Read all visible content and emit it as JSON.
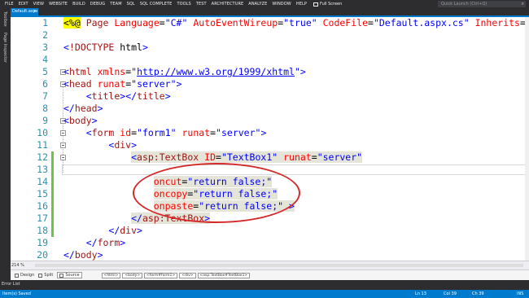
{
  "menubar": {
    "items": [
      "FILE",
      "EDIT",
      "VIEW",
      "WEBSITE",
      "BUILD",
      "DEBUG",
      "TEAM",
      "SQL",
      "SQL COMPLETE",
      "TOOLS",
      "TEST",
      "ARCHITECTURE",
      "ANALYZE",
      "WINDOW",
      "HELP"
    ],
    "fullscreen": "Full Screen",
    "quicklaunch_placeholder": "Quick Launch (Ctrl+Q)"
  },
  "tab": {
    "label": "Default.aspx",
    "close": "×"
  },
  "sidebar": {
    "labels": [
      "Toolbox",
      "Page Inspector"
    ]
  },
  "editor": {
    "lines": [
      {
        "n": "1",
        "text": "<%@ Page Language=\"C#\" AutoEventWireup=\"true\" CodeFile=\"Default.aspx.cs\" Inherits=\"_Def"
      },
      {
        "n": "2",
        "text": ""
      },
      {
        "n": "3",
        "text": "<!DOCTYPE html>"
      },
      {
        "n": "4",
        "text": ""
      },
      {
        "n": "5",
        "text": "<html xmlns=\"http://www.w3.org/1999/xhtml\">"
      },
      {
        "n": "6",
        "text": "<head runat=\"server\">"
      },
      {
        "n": "7",
        "text": "    <title></title>"
      },
      {
        "n": "8",
        "text": "</head>"
      },
      {
        "n": "9",
        "text": "<body>"
      },
      {
        "n": "10",
        "text": "    <form id=\"form1\" runat=\"server\">"
      },
      {
        "n": "11",
        "text": "        <div>"
      },
      {
        "n": "12",
        "text": "            <asp:TextBox ID=\"TextBox1\" runat=\"server\""
      },
      {
        "n": "13",
        "text": ""
      },
      {
        "n": "14",
        "text": "                oncut=\"return false;\""
      },
      {
        "n": "15",
        "text": "                oncopy=\"return false;\""
      },
      {
        "n": "16",
        "text": "                onpaste=\"return false;\" >"
      },
      {
        "n": "17",
        "text": "            </asp:TextBox>"
      },
      {
        "n": "18",
        "text": "        </div>"
      },
      {
        "n": "19",
        "text": "    </form>"
      },
      {
        "n": "20",
        "text": "</body>"
      },
      {
        "n": "21",
        "text": "</html>"
      }
    ]
  },
  "statusrow1": {
    "zoom": "214 %"
  },
  "viewbar": {
    "design": "Design",
    "split": "Split",
    "source": "Source",
    "breadcrumbs": [
      "<html>",
      "<body>",
      "<form#form1>",
      "<div>",
      "<asp:TextBox#TextBox1>"
    ]
  },
  "bottompanel": {
    "errorlist": "Error List"
  },
  "statusbar": {
    "message": "Item(s) Saved",
    "ln": "Ln 13",
    "col": "Col 39",
    "ch": "Ch 39",
    "mode": "INS"
  }
}
